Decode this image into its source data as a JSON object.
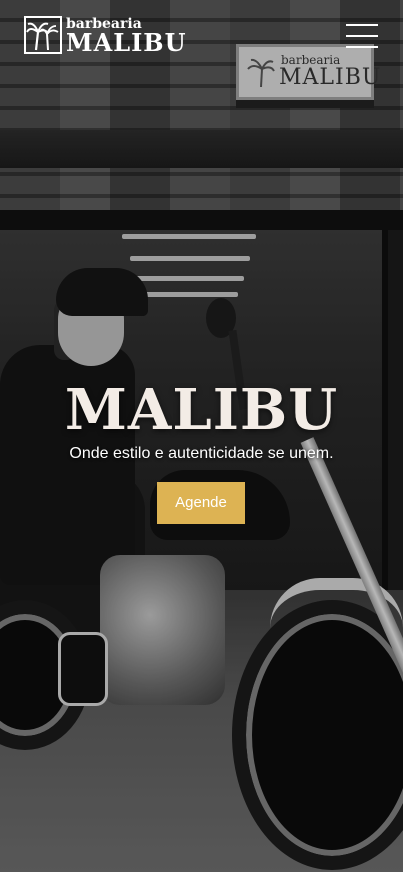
{
  "header": {
    "logo_small": "barbearia",
    "logo_big": "MALIBU",
    "menu_icon": "hamburger-menu-icon"
  },
  "wall_sign": {
    "small": "barbearia",
    "big": "MALIBU"
  },
  "hero": {
    "title": "MALIBU",
    "subtitle": "Onde estilo e autenticidade se unem.",
    "cta_label": "Agende"
  },
  "colors": {
    "accent": "#ddb353",
    "title_text": "#f3ece6",
    "header_text": "#ffffff"
  }
}
